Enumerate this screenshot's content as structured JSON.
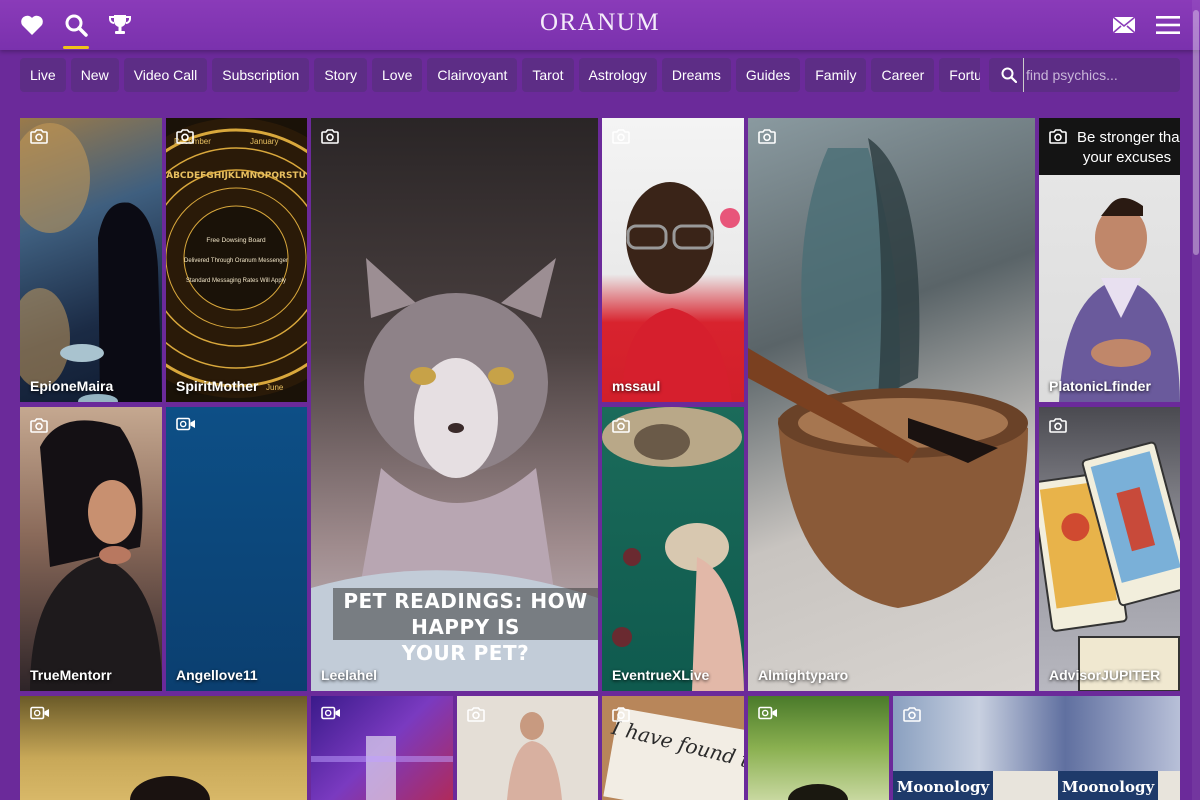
{
  "header": {
    "logo": "ORANUM",
    "favorites_icon": "heart-icon",
    "search_icon": "search-icon",
    "trophy_icon": "trophy-icon",
    "mail_icon": "mail-icon",
    "menu_icon": "hamburger-menu-icon"
  },
  "filters": [
    "Live",
    "New",
    "Video Call",
    "Subscription",
    "Story",
    "Love",
    "Clairvoyant",
    "Tarot",
    "Astrology",
    "Dreams",
    "Guides",
    "Family",
    "Career",
    "Fortu"
  ],
  "search": {
    "placeholder": "find psychics..."
  },
  "colors": {
    "header": "#8a3bb9",
    "background": "#6b2a9a",
    "pill": "#5d2d86",
    "active_underline": "#f0c419"
  },
  "tiles": [
    {
      "name": "EpioneMaira",
      "media": "camera-icon"
    },
    {
      "name": "SpiritMother",
      "media": "camera-icon",
      "board_lines": [
        "Free Dowsing Board",
        "Delivered Through Oranum Messenger",
        "Standard Messaging Rates Will Apply"
      ],
      "months": [
        "December",
        "January",
        "June"
      ],
      "alphabet": "ABCDEFGHIJKLMNOPQRSTU"
    },
    {
      "name": "Leelahel",
      "media": "camera-icon",
      "caption_line1": "PET READINGS: HOW HAPPY IS",
      "caption_line2": "YOUR PET?"
    },
    {
      "name": "mssaul",
      "media": "camera-icon"
    },
    {
      "name": "Almightyparo",
      "media": "camera-icon"
    },
    {
      "name": "PlatonicLfinder",
      "media": "camera-icon",
      "caption_line1": "Be stronger than",
      "caption_line2": "your excuses"
    },
    {
      "name": "TrueMentorr",
      "media": "camera-icon"
    },
    {
      "name": "Angellove11",
      "media": "video-icon"
    },
    {
      "name": "EventrueXLive",
      "media": "camera-icon"
    },
    {
      "name": "AdvisorJUPITER",
      "media": "camera-icon"
    },
    {
      "name": "",
      "media": "video-icon"
    },
    {
      "name": "",
      "media": "video-icon"
    },
    {
      "name": "",
      "media": "camera-icon"
    },
    {
      "name": "",
      "media": "camera-icon",
      "caption_line1": "I have found the On"
    },
    {
      "name": "",
      "media": "video-icon"
    },
    {
      "name": "",
      "media": "camera-icon",
      "card_label": "Moonology"
    }
  ]
}
